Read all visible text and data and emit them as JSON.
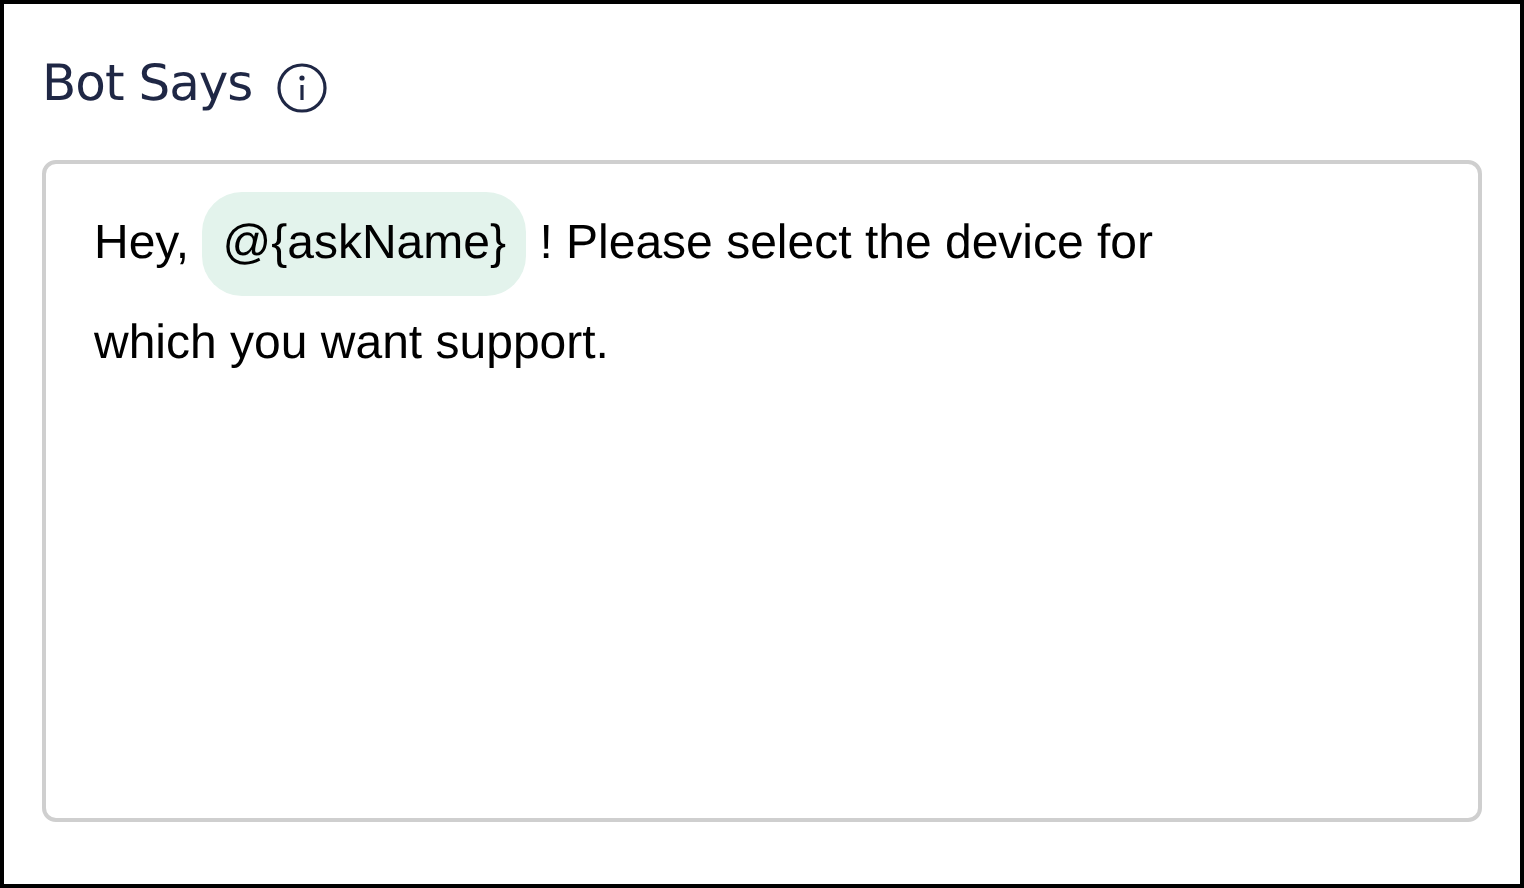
{
  "title": "Bot Says",
  "message": [
    {
      "kind": "text",
      "text": "Hey,"
    },
    {
      "kind": "variable",
      "text": "@{askName}"
    },
    {
      "kind": "text",
      "text": "! Please select the device for"
    },
    {
      "kind": "text",
      "text": "which you want support."
    }
  ]
}
